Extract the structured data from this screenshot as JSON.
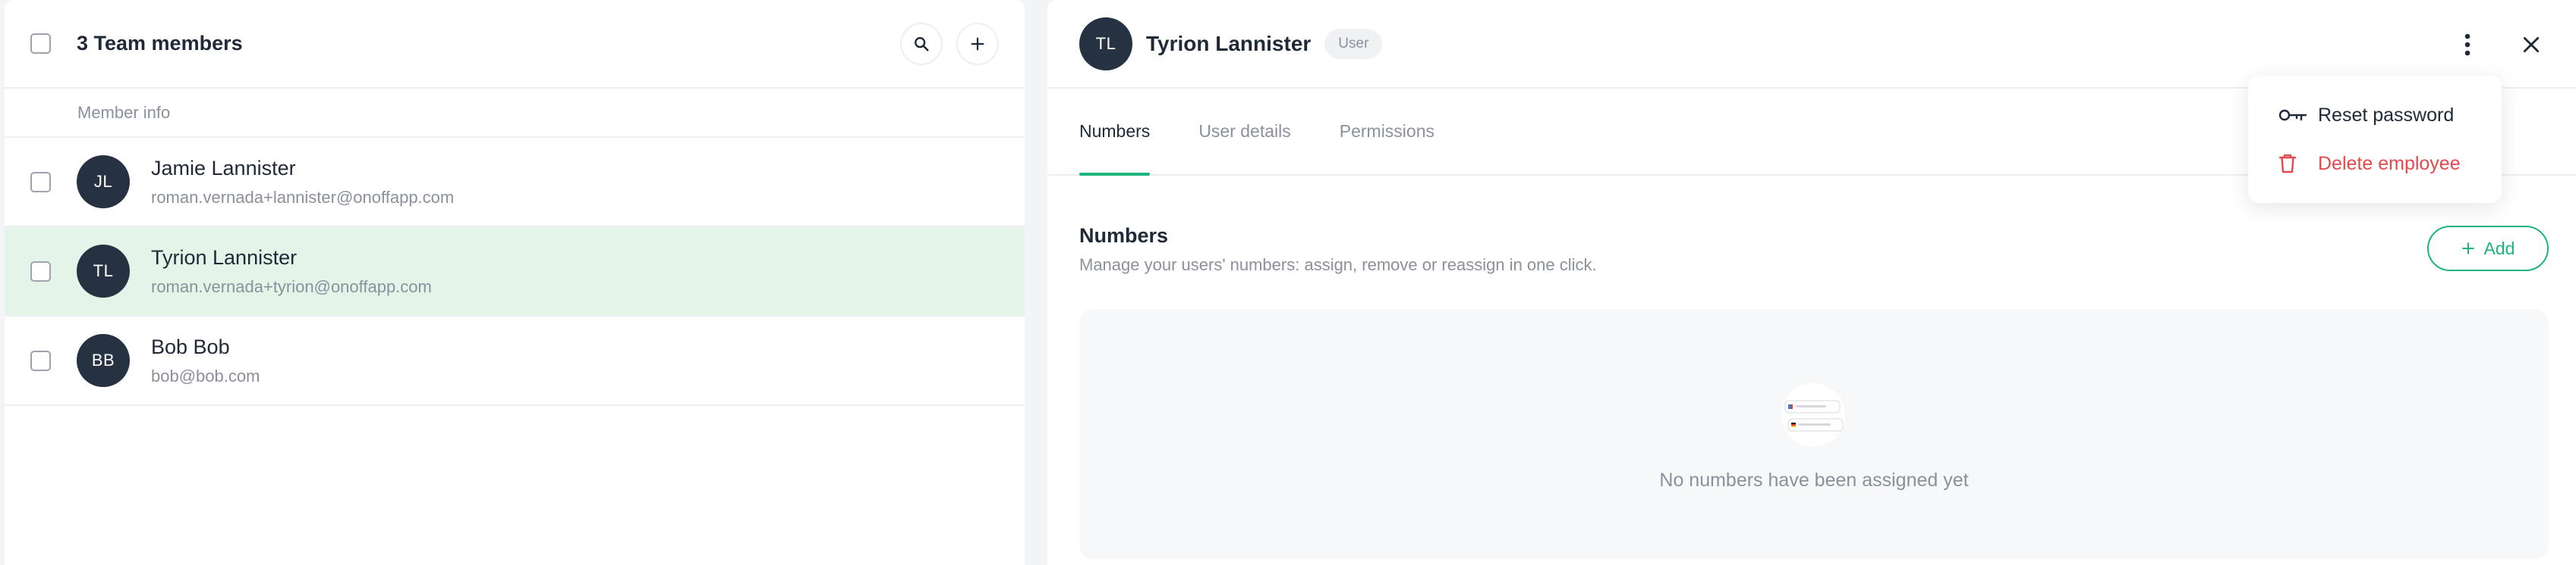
{
  "left_panel": {
    "title": "3 Team members",
    "column_header": "Member info",
    "members": [
      {
        "initials": "JL",
        "name": "Jamie Lannister",
        "email": "roman.vernada+lannister@onoffapp.com",
        "selected": false
      },
      {
        "initials": "TL",
        "name": "Tyrion Lannister",
        "email": "roman.vernada+tyrion@onoffapp.com",
        "selected": true
      },
      {
        "initials": "BB",
        "name": "Bob Bob",
        "email": "bob@bob.com",
        "selected": false
      }
    ]
  },
  "detail": {
    "initials": "TL",
    "name": "Tyrion Lannister",
    "role": "User",
    "tabs": [
      "Numbers",
      "User details",
      "Permissions"
    ],
    "active_tab": "Numbers",
    "section_title": "Numbers",
    "section_description": "Manage your users' numbers: assign, remove or reassign in one click.",
    "add_label": "Add",
    "empty_message": "No numbers have been assigned yet"
  },
  "menu": {
    "items": [
      {
        "label": "Reset password",
        "icon": "key-icon"
      },
      {
        "label": "Delete employee",
        "icon": "trash-icon"
      }
    ]
  },
  "colors": {
    "accent": "#1db57d",
    "danger": "#e5484d",
    "avatar": "#263142",
    "selected_row": "#e4f4e8"
  }
}
